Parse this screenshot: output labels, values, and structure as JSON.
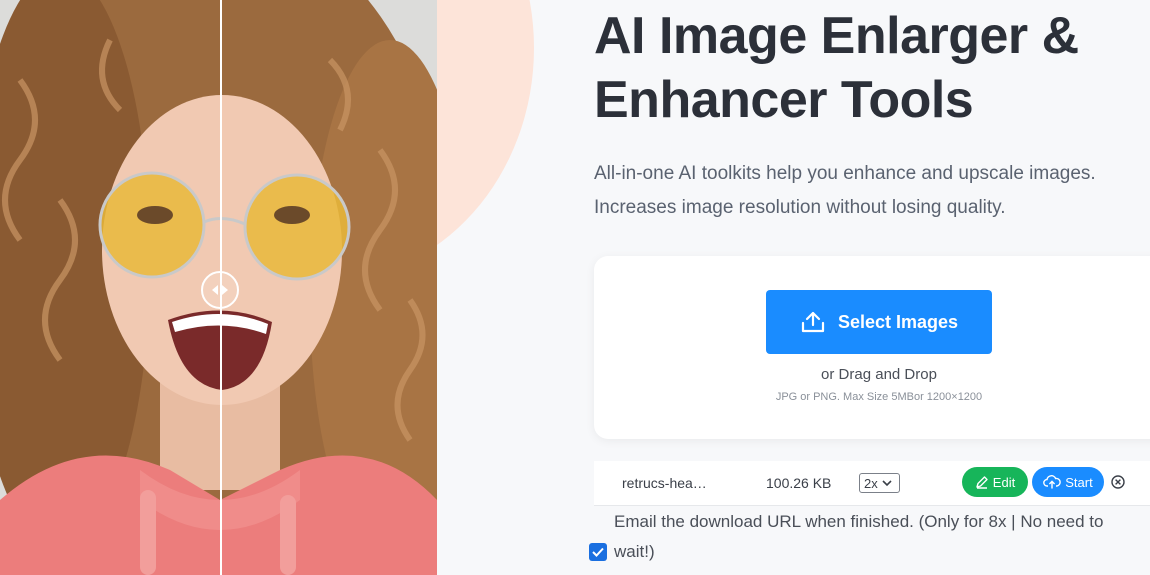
{
  "hero": {
    "title_line1": "AI Image Enlarger &",
    "title_line2": "Enhancer Tools",
    "subtitle_line1": "All-in-one AI toolkits help you enhance and upscale images.",
    "subtitle_line2": "Increases image resolution without losing quality."
  },
  "compare_slider": {
    "position": 0.5,
    "handle_icon": "left-right-arrows-icon"
  },
  "upload": {
    "select_label": "Select Images",
    "select_icon": "upload-icon",
    "drag_text": "or Drag and Drop",
    "limit_text": "JPG or PNG. Max Size 5MBor 1200×1200"
  },
  "file_row": {
    "name": "retrucs-hea…",
    "size": "100.26 KB",
    "scale_value": "2x",
    "edit_label": "Edit",
    "edit_icon": "pencil-icon",
    "start_label": "Start",
    "start_icon": "cloud-upload-icon",
    "remove_icon": "close-circle-icon"
  },
  "email_option": {
    "text_line1": "Email the download URL when finished. (Only for 8x | No need to",
    "text_line2": "wait!)",
    "checked": true
  },
  "colors": {
    "primary": "#1a8cff",
    "success": "#17b55a",
    "accent_circle": "#fde4d9",
    "title": "#2c3039"
  }
}
